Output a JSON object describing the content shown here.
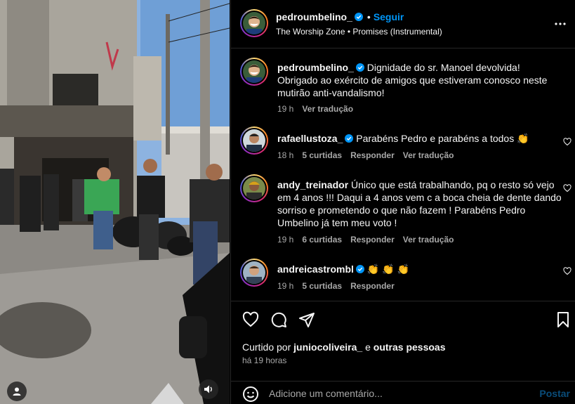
{
  "post": {
    "author": "pedroumbelino_",
    "follow_label": "Seguir",
    "separator": "•",
    "audio": "The Worship Zone • Promises (Instrumental)",
    "more_icon": "more-horizontal-icon"
  },
  "caption": {
    "username": "pedroumbelino_",
    "text": "Dignidade do sr. Manoel devolvida! Obrigado ao exército de amigos que estiveram conosco neste mutirão anti-vandalismo!",
    "time": "19 h",
    "translate": "Ver tradução"
  },
  "comments": [
    {
      "username": "rafaellustoza_",
      "text": "Parabéns Pedro e parabéns a todos 👏",
      "time": "18 h",
      "likes": "5 curtidas",
      "reply": "Responder",
      "translate": "Ver tradução"
    },
    {
      "username": "andy_treinador",
      "text": "Único que está trabalhando, pq o resto só vejo em 4 anos !!! Daqui a 4 anos vem c a boca cheia de dente dando sorriso e prometendo o que não fazem ! Parabéns Pedro Umbelino já tem meu voto !",
      "time": "19 h",
      "likes": "6 curtidas",
      "reply": "Responder",
      "translate": "Ver tradução"
    },
    {
      "username": "andreicastrombl",
      "text": "👏 👏 👏",
      "time": "19 h",
      "likes": "5 curtidas",
      "reply": "Responder"
    }
  ],
  "engagement": {
    "liked_prefix": "Curtido por",
    "liked_user": "juniocoliveira_",
    "liked_joiner": "e",
    "liked_others": "outras pessoas",
    "time": "há 19 horas"
  },
  "comment_box": {
    "placeholder": "Adicione um comentário...",
    "post_label": "Postar"
  },
  "colors": {
    "accent": "#0095f6",
    "muted": "#a8a8a8",
    "background": "#000000",
    "verified": "#0095f6"
  }
}
